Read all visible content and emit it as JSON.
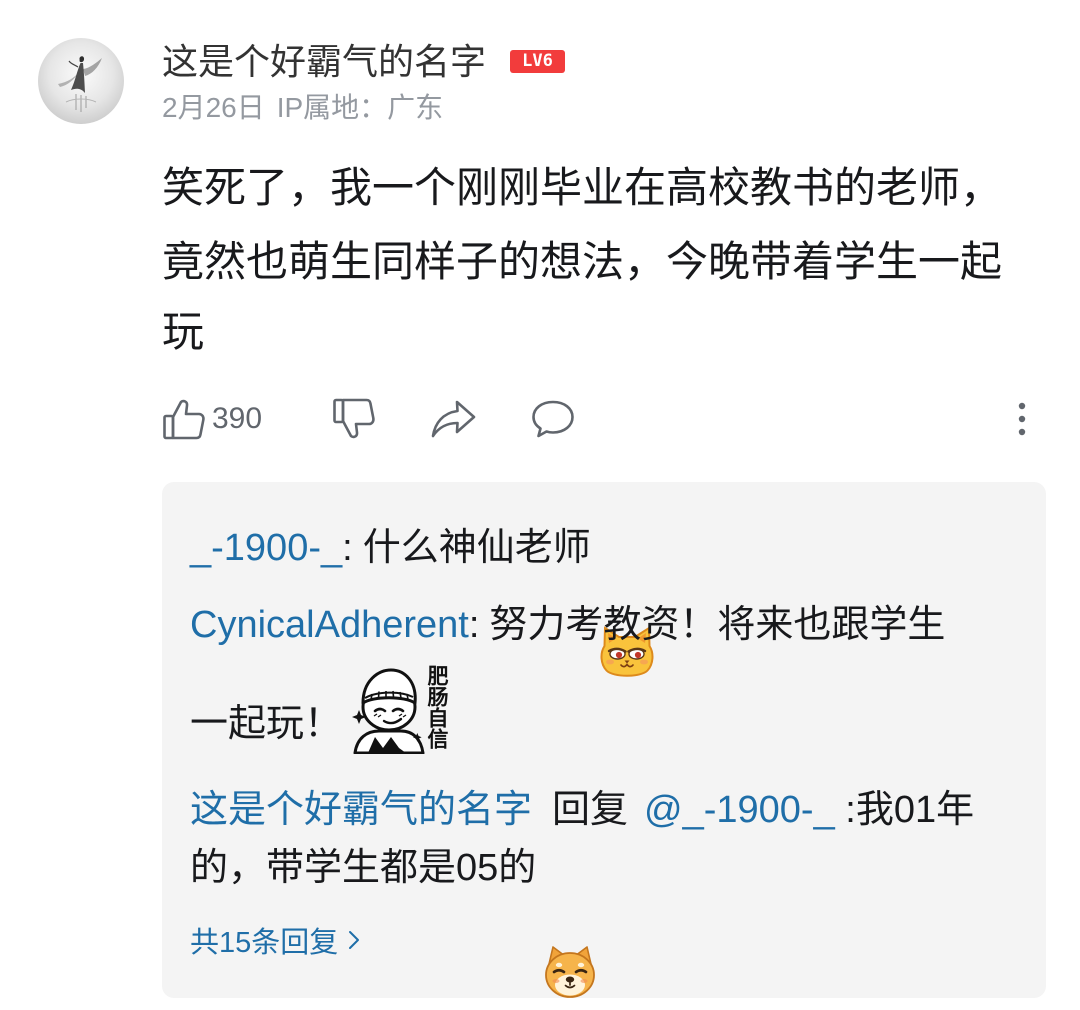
{
  "comment": {
    "username": "这是个好霸气的名字",
    "level_badge": "LV6",
    "date": "2月26日",
    "ip_location": "IP属地：广东",
    "text_lines": [
      "笑死了，我一个刚刚毕业在高校教书的老师，",
      "竟然也萌生同样子的想法，今晚带着学生一起",
      "玩"
    ],
    "actions": {
      "like": {
        "icon": "thumbs-up",
        "count": "390"
      },
      "dislike": {
        "icon": "thumbs-down"
      },
      "share": {
        "icon": "share-arrow"
      },
      "reply": {
        "icon": "comment-bubble"
      },
      "more": {
        "icon": "more-vertical"
      }
    }
  },
  "replies": [
    {
      "user": "_-1900-_",
      "separator": ":",
      "text_lines": [
        "什么神仙老师"
      ],
      "emoji": "cat-face"
    },
    {
      "user": "CynicalAdherent",
      "separator": ":",
      "text_lines": [
        "努力考教资！将来也跟学生",
        "一起玩！"
      ],
      "sticker": {
        "icon": "confident-face-sticker",
        "label": "肥肠自信"
      }
    },
    {
      "user": "这是个好霸气的名字",
      "reply_word": "回复",
      "mention": "@_-1900-_",
      "separator": " :",
      "text_lines": [
        "我01年",
        "的，带学生都是05的"
      ],
      "emoji": "doge"
    }
  ],
  "more_replies": {
    "label": "共15条回复",
    "icon": "chevron-right"
  },
  "colors": {
    "link": "#1f6ea8",
    "text": "#18191c",
    "name": "#333333",
    "meta": "#9499a0",
    "icon": "#61666d",
    "badge": "#f23c3c",
    "panel": "#f4f4f4"
  }
}
